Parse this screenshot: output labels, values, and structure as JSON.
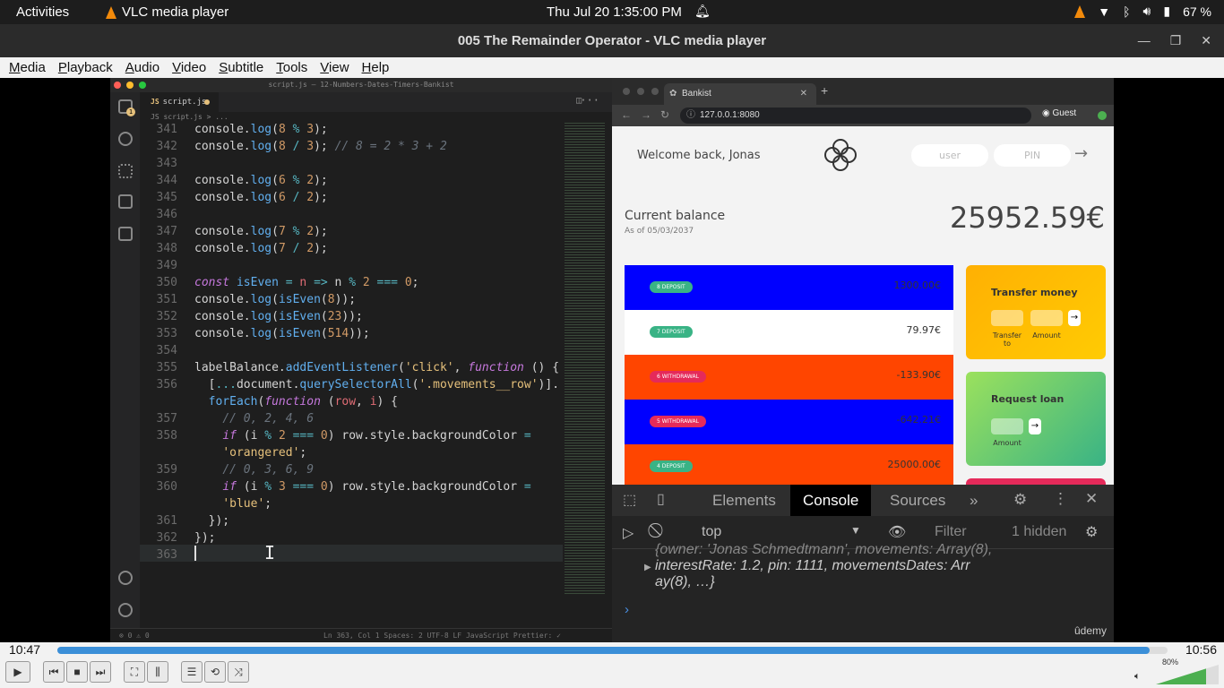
{
  "topbar": {
    "activities": "Activities",
    "app_name": "VLC media player",
    "clock": "Thu Jul 20  1:35:00 PM",
    "battery": "67 %"
  },
  "window": {
    "title": "005 The Remainder Operator - VLC media player"
  },
  "menu": {
    "media": "Media",
    "playback": "Playback",
    "audio": "Audio",
    "video": "Video",
    "subtitle": "Subtitle",
    "tools": "Tools",
    "view": "View",
    "help": "Help"
  },
  "editor": {
    "title": "script.js — 12-Numbers-Dates-Timers-Bankist",
    "tab": "script.js",
    "tab_prefix": "JS",
    "breadcrumb": "JS script.js > ...",
    "activity_badge": "1",
    "status_left": "⊗ 0 ⚠ 0",
    "status_right": "Ln 363, Col 1    Spaces: 2    UTF-8    LF    JavaScript    Prettier: ✓",
    "line_numbers": [
      "341",
      "342",
      "343",
      "344",
      "345",
      "346",
      "347",
      "348",
      "349",
      "350",
      "351",
      "352",
      "353",
      "354",
      "355",
      "356",
      "",
      "357",
      "358",
      "",
      "359",
      "360",
      "",
      "361",
      "362",
      "363"
    ]
  },
  "browser": {
    "tab_title": "Bankist",
    "url": "127.0.0.1:8080",
    "profile": "Guest",
    "app": {
      "welcome": "Welcome back, Jonas",
      "user_placeholder": "user",
      "pin_placeholder": "PIN",
      "login_arrow": "→",
      "current_balance": "Current balance",
      "as_of": "As of 05/03/2037",
      "balance": "25952.59€",
      "movements": [
        {
          "badge": "8 DEPOSIT",
          "amount": "1300.00€"
        },
        {
          "badge": "7 DEPOSIT",
          "amount": "79.97€"
        },
        {
          "badge": "6 WITHDRAWAL",
          "amount": "-133.90€"
        },
        {
          "badge": "5 WITHDRAWAL",
          "amount": "-642.21€"
        },
        {
          "badge": "4 DEPOSIT",
          "amount": "25000.00€"
        }
      ],
      "transfer": {
        "title": "Transfer money",
        "label_to": "Transfer to",
        "label_amount": "Amount",
        "btn": "→"
      },
      "loan": {
        "title": "Request loan",
        "label_amount": "Amount",
        "btn": "→"
      }
    },
    "devtools": {
      "tabs": [
        "Elements",
        "Console",
        "Sources"
      ],
      "more": "»",
      "context": "top",
      "filter": "Filter",
      "hidden": "1 hidden",
      "output_line1": "{owner: 'Jonas Schmedtmann', movements: Array(8),",
      "output_line2": "interestRate: 1.2, pin: 1111, movementsDates: Arr",
      "output_line3": "ay(8), …}",
      "prompt": "›",
      "watermark": "ûdemy"
    }
  },
  "player": {
    "elapsed": "10:47",
    "total": "10:56",
    "progress": 0.984,
    "volume": "80%",
    "volume_level": 0.8
  },
  "colors": {
    "accent": "#3b8fd8",
    "deposit": "#39b385",
    "withdrawal": "#e52a5a",
    "row_blue": "#0000ff",
    "row_orange": "#ff4500"
  }
}
